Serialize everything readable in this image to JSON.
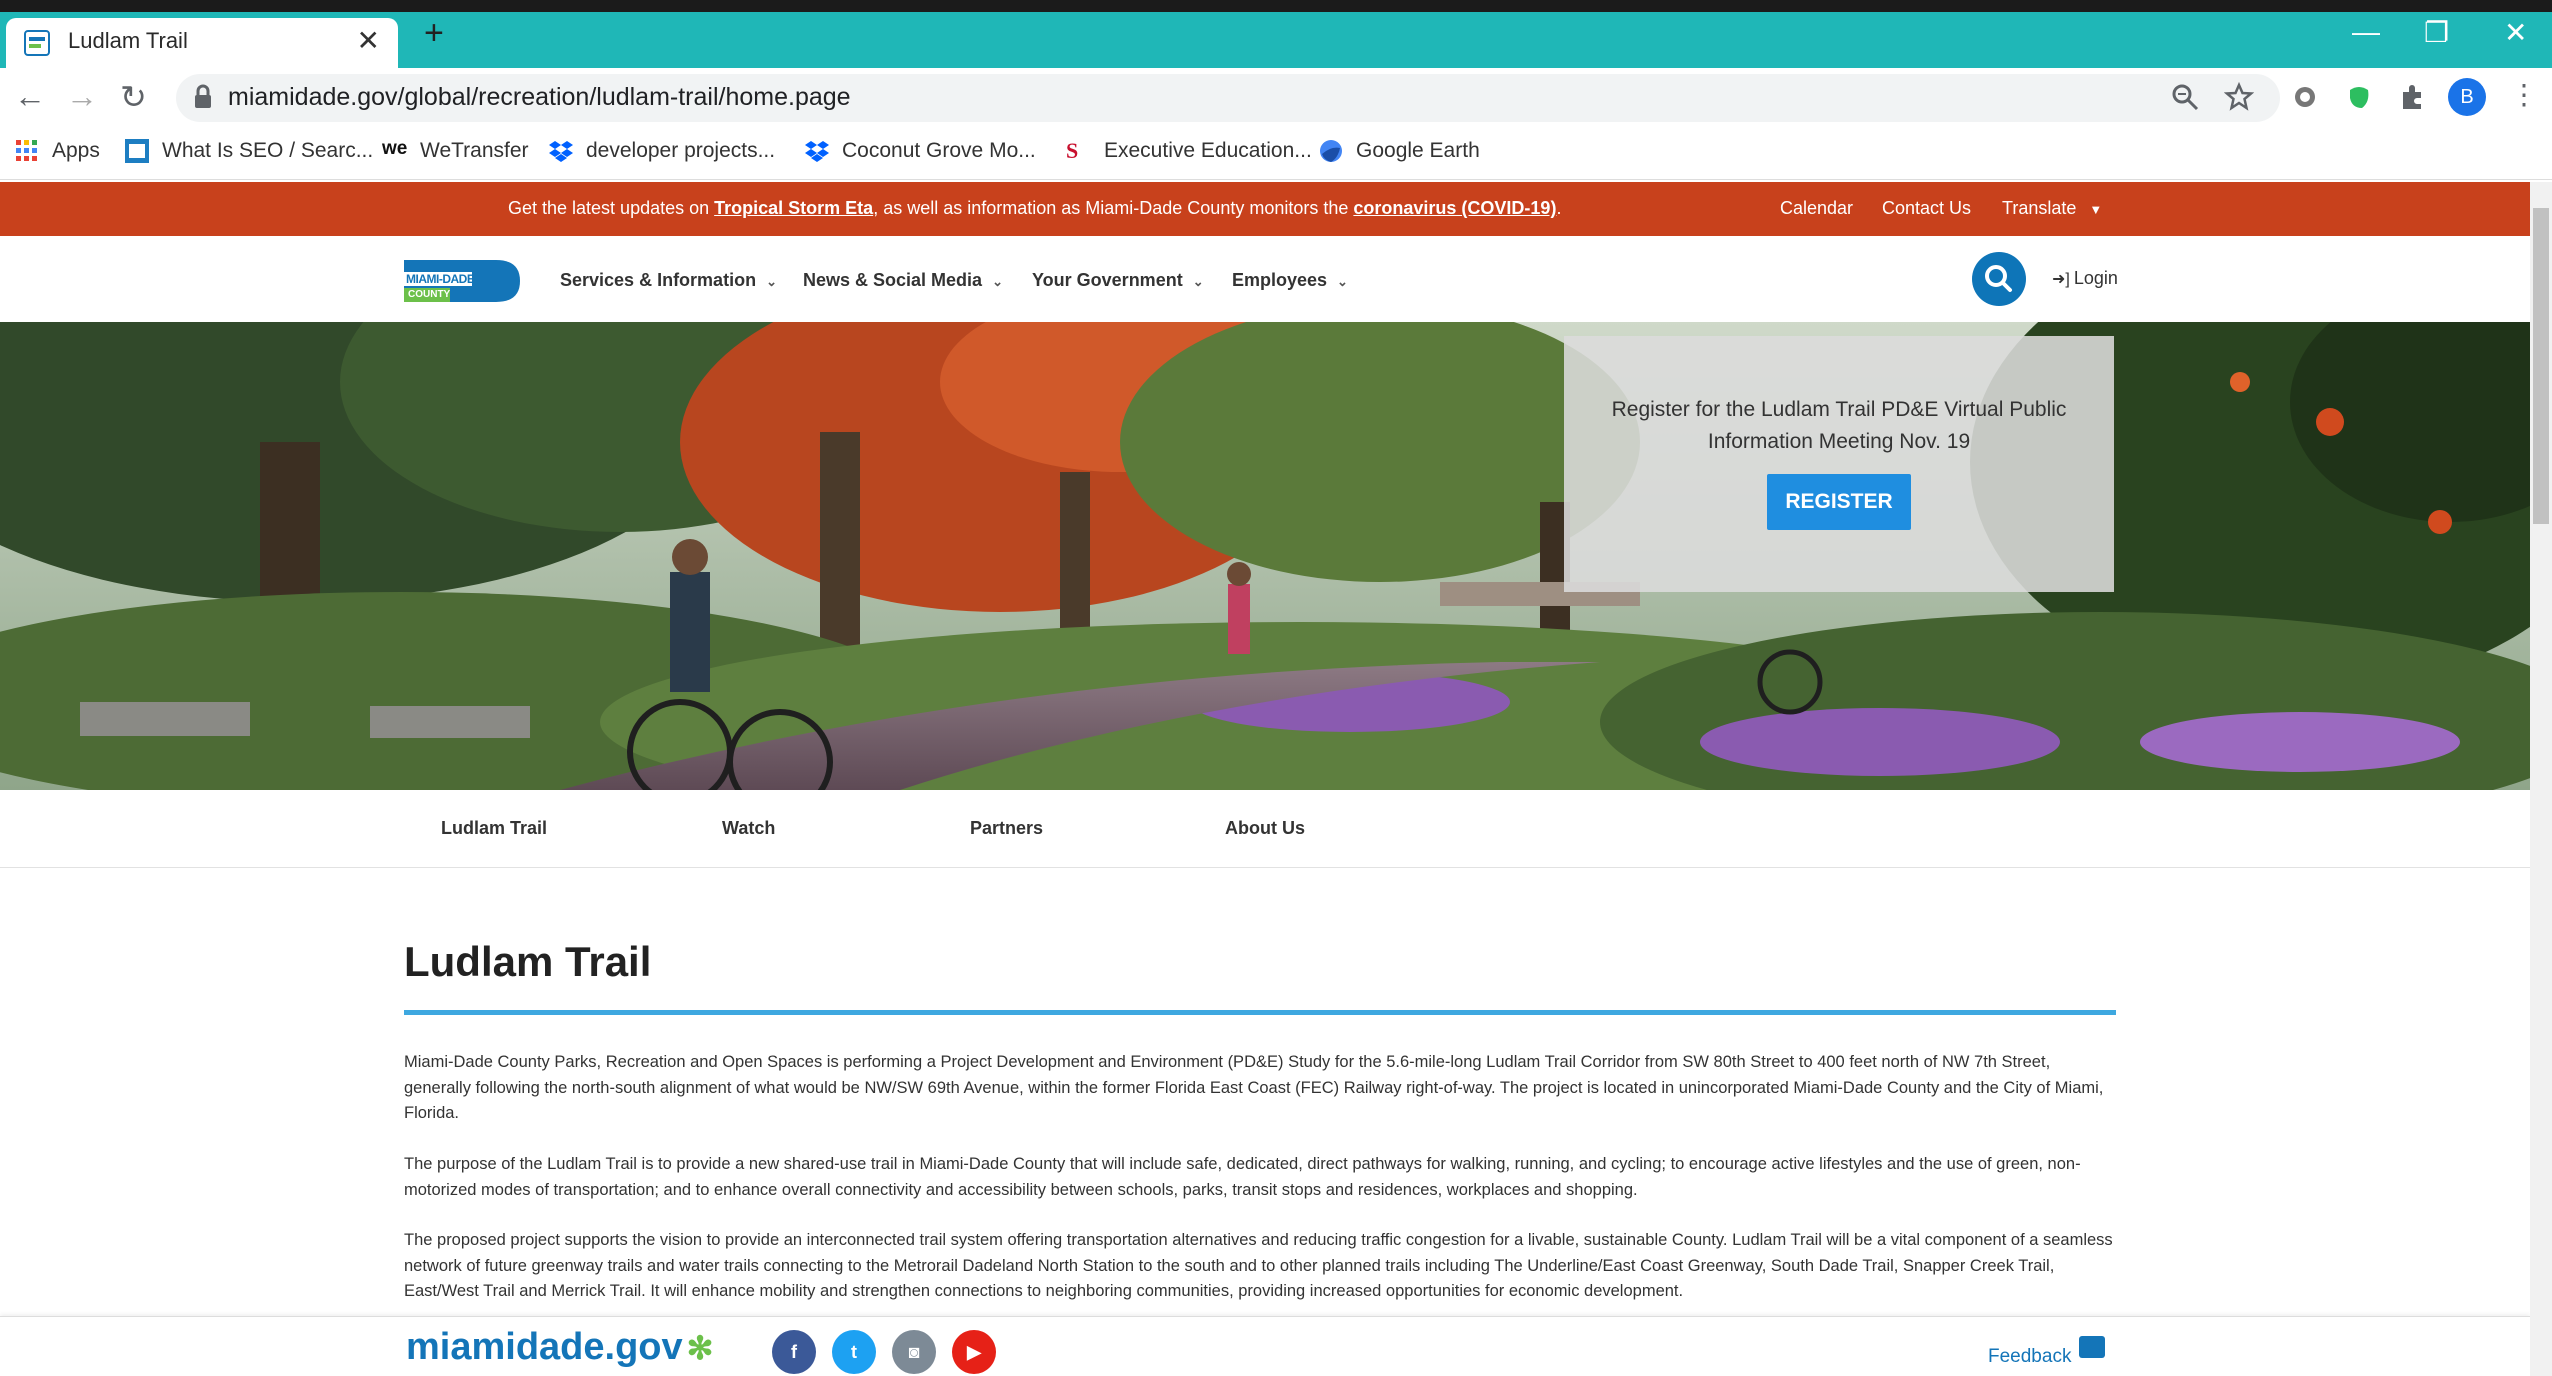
{
  "browser": {
    "tab_title": "Ludlam Trail",
    "url": "miamidade.gov/global/recreation/ludlam-trail/home.page",
    "profile_initial": "B",
    "bookmarks": [
      "Apps",
      "What Is SEO / Searc...",
      "WeTransfer",
      "developer projects...",
      "Coconut Grove Mo...",
      "Executive Education...",
      "Google Earth"
    ]
  },
  "alert": {
    "prefix": "Get the latest updates on ",
    "link1": "Tropical Storm Eta",
    "middle": ", as well as information as Miami-Dade County monitors the ",
    "link2": "coronavirus (COVID-19)",
    "suffix": ".",
    "calendar": "Calendar",
    "contact": "Contact Us",
    "translate": "Translate"
  },
  "header": {
    "logo_top": "MIAMI-DADE",
    "logo_bottom": "COUNTY",
    "nav": [
      "Services & Information",
      "News & Social Media",
      "Your Government",
      "Employees"
    ],
    "login": "Login"
  },
  "promo": {
    "text": "Register for the Ludlam Trail PD&E Virtual Public Information Meeting Nov. 19",
    "button": "REGISTER"
  },
  "subnav": [
    "Ludlam Trail",
    "Watch",
    "Partners",
    "About Us"
  ],
  "content": {
    "title": "Ludlam Trail",
    "paragraphs": [
      "Miami-Dade County Parks, Recreation and Open Spaces is performing a Project Development and Environment (PD&E) Study for the 5.6-mile-long Ludlam Trail Corridor from SW 80th Street to 400 feet north of NW 7th Street, generally following the north-south alignment of what would be NW/SW 69th Avenue, within the former Florida East Coast (FEC) Railway right-of-way. The project is located in unincorporated Miami-Dade County and the City of Miami, Florida.",
      "The purpose of the Ludlam Trail is to provide a new shared-use trail in Miami-Dade County that will include safe, dedicated, direct pathways for walking, running, and cycling; to encourage active lifestyles and the use of green, non-motorized modes of transportation; and to enhance overall connectivity and accessibility between schools, parks, transit stops and residences, workplaces and shopping.",
      "The proposed project supports the vision to provide an interconnected trail system offering transportation alternatives and reducing traffic congestion for a livable, sustainable County. Ludlam Trail will be a vital component of a seamless network of future greenway trails and water trails connecting to the Metrorail Dadeland North Station to the south and to other planned trails including The Underline/East Coast Greenway, South Dade Trail, Snapper Creek Trail, East/West Trail and Merrick Trail. It will enhance mobility and strengthen connections to neighboring communities, providing increased opportunities for economic development."
    ]
  },
  "footer": {
    "logo": "miamidade.gov",
    "feedback": "Feedback"
  },
  "colors": {
    "tabbar": "#1fb7b7",
    "alert": "#c8411c",
    "accent": "#0e75b8",
    "rule": "#3ea8e0"
  }
}
